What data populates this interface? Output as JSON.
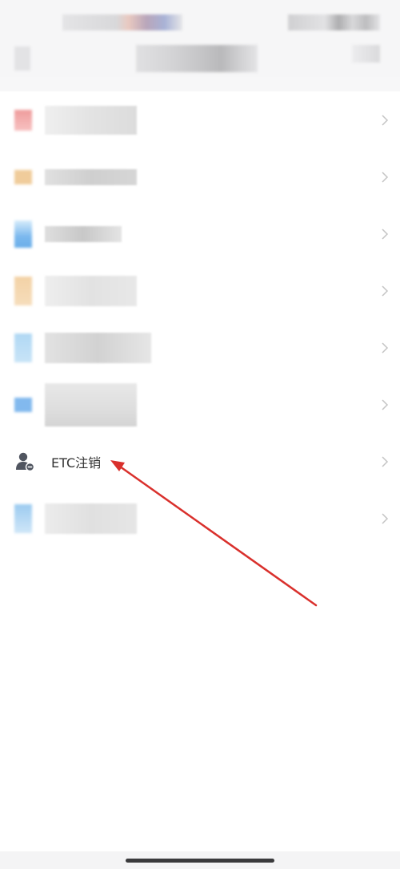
{
  "menu": {
    "items": [
      {
        "id": "item-1",
        "icon": "red-pixelated-icon",
        "label_redacted": true,
        "color": "#f2a3a3"
      },
      {
        "id": "item-2",
        "icon": "orange-pixelated-icon",
        "label_redacted": true,
        "color": "#f3cf9e"
      },
      {
        "id": "item-3",
        "icon": "blue-pixelated-icon",
        "label_redacted": true,
        "color": "#8ec2ef"
      },
      {
        "id": "item-4",
        "icon": "orange-pixelated-icon",
        "label_redacted": true,
        "color": "#f4d6ad"
      },
      {
        "id": "item-5",
        "icon": "blue-pixelated-icon",
        "label_redacted": true,
        "color": "#b7dcf5"
      },
      {
        "id": "item-6",
        "icon": "blue-pixelated-icon",
        "label_redacted": true,
        "color": "#86bcef"
      },
      {
        "id": "etc-cancel",
        "icon": "user-remove-icon",
        "label": "ETC注销",
        "label_redacted": false
      },
      {
        "id": "item-8",
        "icon": "blue-pixelated-icon",
        "label_redacted": true,
        "color": "#a9d1f2"
      }
    ]
  },
  "annotation": {
    "type": "arrow",
    "color": "#d9302c",
    "points_to": "etc-cancel"
  },
  "colors": {
    "text": "#333333",
    "chevron": "#c4c4c4",
    "icon_gray": "#505560",
    "background": "#ffffff"
  }
}
